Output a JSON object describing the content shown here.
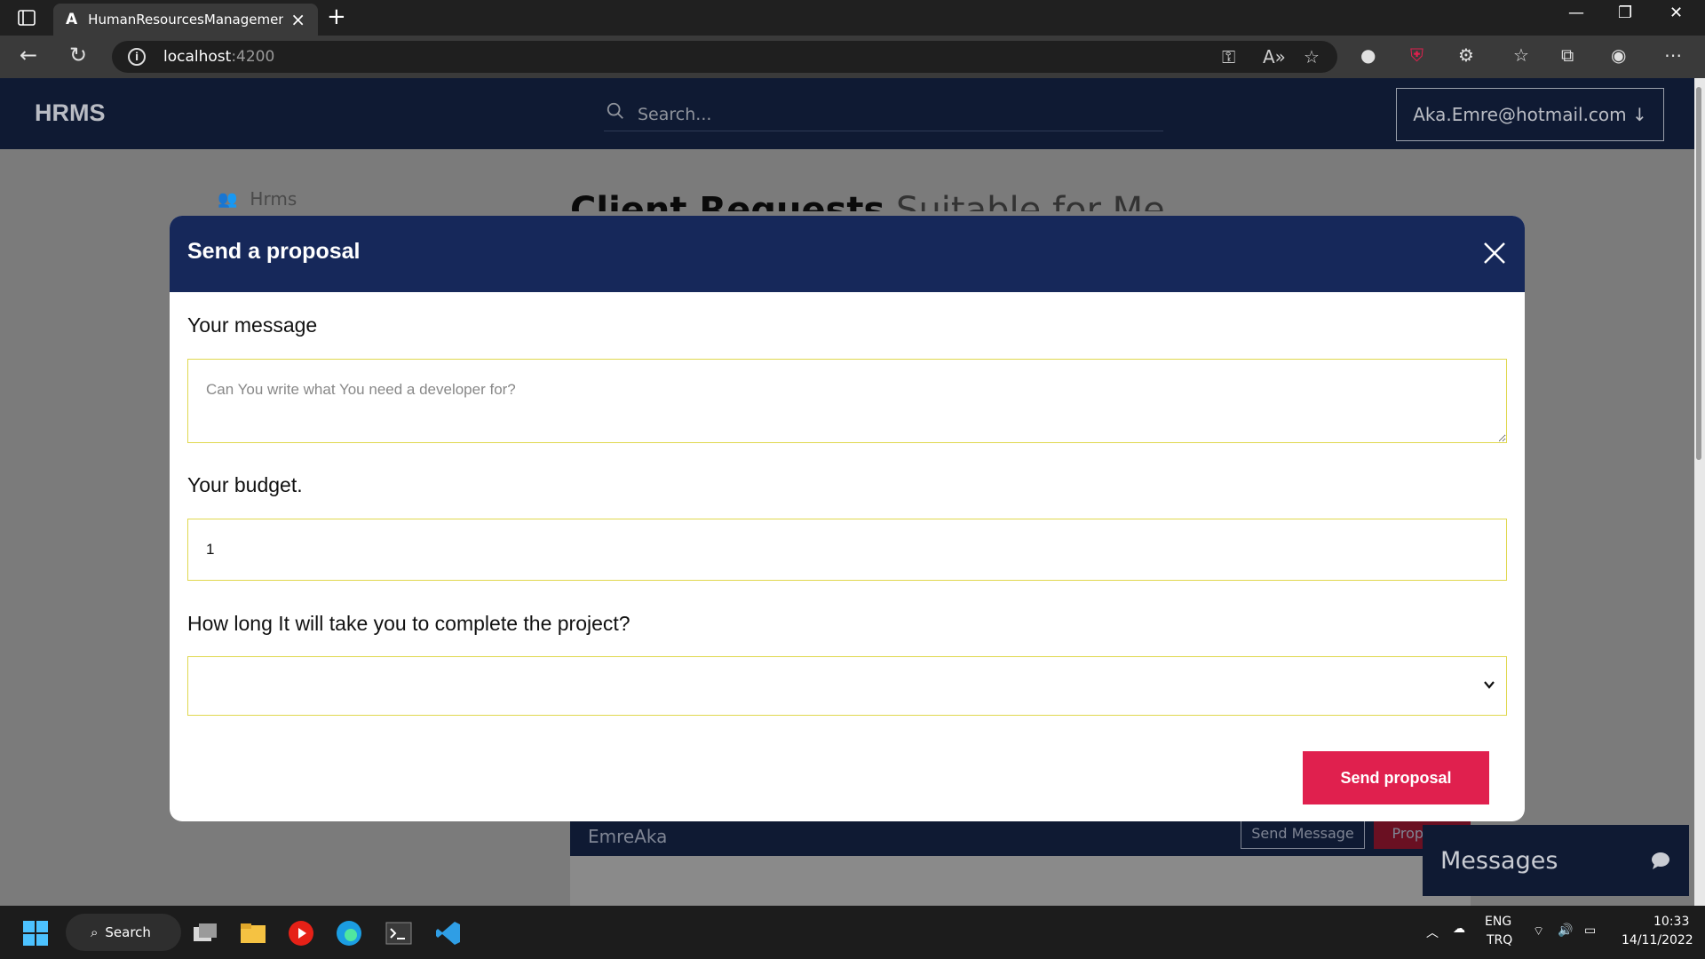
{
  "browser": {
    "tab_title": "HumanResourcesManagementSy",
    "url_host": "localhost",
    "url_port": ":4200"
  },
  "app": {
    "brand": "HRMS",
    "search_placeholder": "Search...",
    "user_email": "Aka.Emre@hotmail.com ↓",
    "sidebar_top_item": "Hrms",
    "heading_bold": "Client Requests",
    "heading_light": " Suitable for Me",
    "card_name": "EmreAka",
    "card_send_message": "Send Message",
    "card_proposal": "Proposal",
    "messages_label": "Messages"
  },
  "modal": {
    "title": "Send a proposal",
    "message_label": "Your message",
    "message_placeholder": "Can You write what You need a developer for?",
    "budget_label": "Your budget.",
    "budget_value": "1",
    "duration_label": "How long It will take you to complete the project?",
    "duration_selected": "",
    "send_label": "Send proposal"
  },
  "taskbar": {
    "search_label": "Search",
    "lang_top": "ENG",
    "lang_bottom": "TRQ",
    "time": "10:33",
    "date": "14/11/2022"
  },
  "colors": {
    "nav_bg": "#0f1a33",
    "modal_header": "#16285a",
    "accent_button": "#e0204e",
    "field_border": "#e0d84f"
  }
}
